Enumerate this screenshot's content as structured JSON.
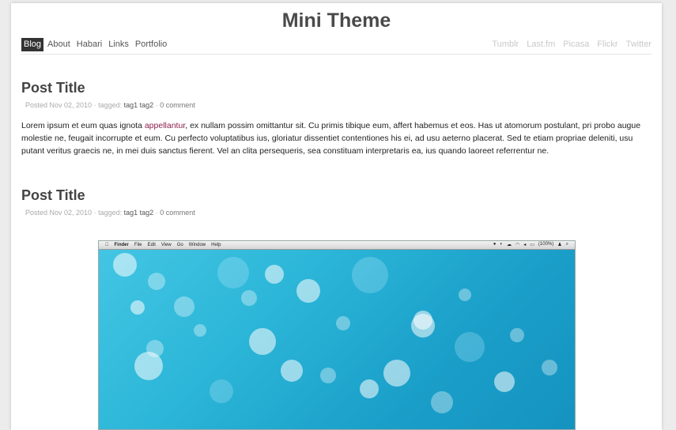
{
  "site": {
    "title": "Mini Theme"
  },
  "nav": {
    "left": [
      "Blog",
      "About",
      "Habari",
      "Links",
      "Portfolio"
    ],
    "right": [
      "Tumblr",
      "Last.fm",
      "Picasa",
      "Flickr",
      "Twitter"
    ]
  },
  "posts": [
    {
      "title": "Post Title",
      "posted": "Posted Nov 02, 2010",
      "tagged_label": "tagged:",
      "tags": [
        "tag1",
        "tag2"
      ],
      "comments": "0 comment",
      "body_before": "Lorem ipsum et eum quas ignota ",
      "body_link": "appellantur",
      "body_after": ", ex nullam possim omittantur sit. Cu primis tibique eum, affert habemus et eos. Has ut atomorum postulant, pri probo augue molestie ne, feugait incorrupte et eum. Cu perfecto voluptatibus ius, gloriatur dissentiet contentiones his ei, ad usu aeterno placerat. Sed te etiam propriae deleniti, usu putant veritus graecis ne, in mei duis sanctus fierent. Vel an clita persequeris, sea constituam interpretaris ea, ius quando laoreet referrentur ne."
    },
    {
      "title": "Post Title",
      "posted": "Posted Nov 02, 2010",
      "tagged_label": "tagged:",
      "tags": [
        "tag1",
        "tag2"
      ],
      "comments": "0 comment"
    }
  ],
  "screenshot": {
    "menu": [
      "Finder",
      "File",
      "Edit",
      "View",
      "Go",
      "Window",
      "Help"
    ],
    "status": [
      "(100%)"
    ]
  }
}
